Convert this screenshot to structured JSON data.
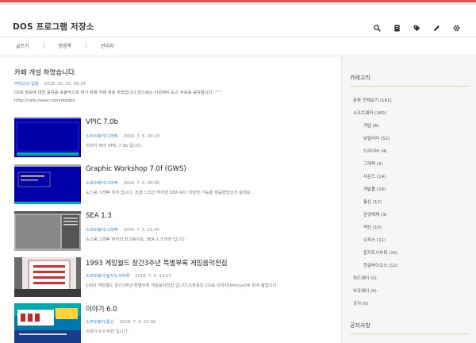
{
  "site": {
    "title": "DOS 프로그램 저장소"
  },
  "header_icons": [
    "search-icon",
    "list-icon",
    "tag-icon",
    "pencil-icon",
    "gear-icon"
  ],
  "nav": [
    "글쓰기",
    "방명록",
    "관리자"
  ],
  "notice": {
    "title": "카페 개설 하였습니다.",
    "category": "카테고리 없음",
    "date": "2016. 10. 25. 09:24",
    "body": "DOS 정보에 대한 공유를 효율적으로 하기 위해 카페 개설 하였습니다.앞으로는 이곳에서 도스 자료를 공유합니다. ^^",
    "link": "http://cafe.naver.com/olddos"
  },
  "posts": [
    {
      "title": "VPIC 7.0b",
      "category": "소프트웨어/그래픽",
      "date": "2016. 7. 6. 00:10",
      "desc": "이미지 뷰어 VPIC 7.0b 입니다."
    },
    {
      "title": "Graphic Workshop 7.0f (GWS)",
      "category": "소프트웨어/그래픽",
      "date": "2016. 7. 6. 00:06",
      "desc": "도스용 그래픽 뷰어 입니다. 조금 느리긴 하지만 SEA 보다 다양한 기능을 제공했었던것 같네요."
    },
    {
      "title": "SEA 1.3",
      "category": "소프트웨어/그래픽",
      "date": "2016. 7. 5. 23:55",
      "desc": "도스용 그래픽 뷰어의 최고봉이죠. SEA 1.3 버전 입니다."
    },
    {
      "title": "1993 게임월드 창간3주년 특별부록 게임음악전집",
      "category": "소프트웨어/잡지도서부록",
      "date": "2016. 7. 4. 23:57",
      "desc": "1993 게임월드 창간3주년 특별부록 게임음악전집 입니다.소장중인 CD를 이미지(bin/cue)로 떠서 올립니다."
    },
    {
      "title": "이야기 6.0",
      "category": "소프트웨어/통신",
      "date": "2016. 7. 4. 23:00",
      "desc": "이야기 6.0 버전 입니다."
    }
  ],
  "sidebar": {
    "category_title": "카테고리",
    "categories": [
      {
        "label": "분류 전체보기 (161)",
        "level": 0
      },
      {
        "label": "소프트웨어 (160)",
        "level": 0
      },
      {
        "label": "게임 (6)",
        "level": 1
      },
      {
        "label": "유틸리티 (52)",
        "level": 1
      },
      {
        "label": "드라이버 (4)",
        "level": 1
      },
      {
        "label": "그래픽 (5)",
        "level": 1
      },
      {
        "label": "사운드 (14)",
        "level": 1
      },
      {
        "label": "개발툴 (16)",
        "level": 1
      },
      {
        "label": "통신 (12)",
        "level": 1
      },
      {
        "label": "운영체제 (3)",
        "level": 1
      },
      {
        "label": "백신 (10)",
        "level": 1
      },
      {
        "label": "오피스 (11)",
        "level": 1
      },
      {
        "label": "잡지도서부록 (15)",
        "level": 1
      },
      {
        "label": "한글바이오스 (12)",
        "level": 1
      },
      {
        "label": "하드웨어 (0)",
        "level": 0
      },
      {
        "label": "브유웨어 (0)",
        "level": 0
      },
      {
        "label": "공지 (0)",
        "level": 0
      }
    ],
    "notice_title": "공지사항"
  },
  "colors": {
    "accent": "#e5534b",
    "link": "#3a8bd6",
    "dos_blue": "#0000aa",
    "sidebar_bg": "#f6f6f6"
  }
}
